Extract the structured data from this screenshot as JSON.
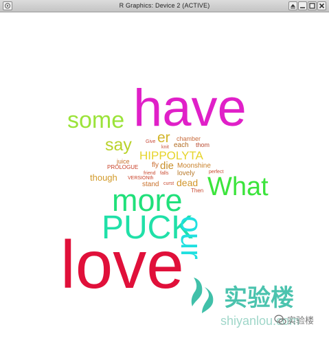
{
  "window": {
    "title": "R Graphics: Device 2 (ACTIVE)",
    "icons": {
      "menu": "window-menu-icon",
      "shade": "shade-icon",
      "minimize": "minimize-icon",
      "maximize": "maximize-icon",
      "close": "close-icon"
    }
  },
  "wordcloud": {
    "words": [
      {
        "text": "have",
        "color": "#e020c8"
      },
      {
        "text": "love",
        "color": "#e0103a"
      },
      {
        "text": "some",
        "color": "#9be33a"
      },
      {
        "text": "say",
        "color": "#b9d22a"
      },
      {
        "text": "er",
        "color": "#d2b52a"
      },
      {
        "text": "chamber",
        "color": "#c86a3a"
      },
      {
        "text": "Give",
        "color": "#c84a3a"
      },
      {
        "text": "knit",
        "color": "#c8503a"
      },
      {
        "text": "each",
        "color": "#b06a20"
      },
      {
        "text": "thom",
        "color": "#b84a30"
      },
      {
        "text": "HIPPOLYTA",
        "color": "#e6d42a"
      },
      {
        "text": "juice",
        "color": "#c8702a"
      },
      {
        "text": "PROLOGUE",
        "color": "#c84028"
      },
      {
        "text": "fly",
        "color": "#c8682a"
      },
      {
        "text": "die",
        "color": "#c8902a"
      },
      {
        "text": "Moonshine",
        "color": "#c8802a"
      },
      {
        "text": "friend",
        "color": "#c84a30"
      },
      {
        "text": "falls",
        "color": "#c84a30"
      },
      {
        "text": "lovely",
        "color": "#b87a2a"
      },
      {
        "text": "perfect",
        "color": "#c84a30"
      },
      {
        "text": "though",
        "color": "#d29a2a"
      },
      {
        "text": "VERSIONth",
        "color": "#c84028"
      },
      {
        "text": "stand",
        "color": "#c8702a"
      },
      {
        "text": "curst",
        "color": "#c84a30"
      },
      {
        "text": "dead",
        "color": "#d2962a"
      },
      {
        "text": "Then",
        "color": "#c84a30"
      },
      {
        "text": "What",
        "color": "#3ce43c"
      },
      {
        "text": "more",
        "color": "#20e07a"
      },
      {
        "text": "PUCK",
        "color": "#20e0a8"
      },
      {
        "text": "our",
        "color": "#20e0e0"
      }
    ]
  },
  "watermark": {
    "brand": "实验楼",
    "domain": "shiyanlou.com",
    "account": "实验楼",
    "logo_color": "#1fb59a"
  }
}
